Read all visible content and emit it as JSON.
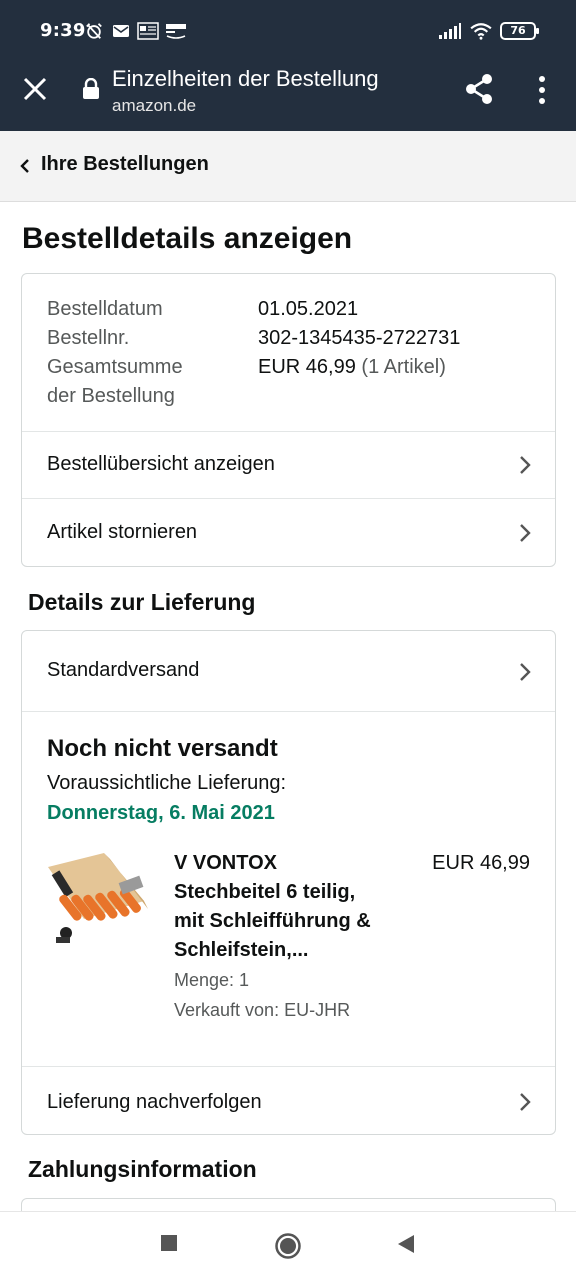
{
  "status_bar": {
    "time": "9:39",
    "battery": "76",
    "icons": [
      "alarm-off-icon",
      "mail-icon",
      "news-icon",
      "amazon-icon",
      "signal-icon",
      "wifi-icon",
      "battery-icon"
    ]
  },
  "browser": {
    "title": "Einzelheiten der Bestellung",
    "domain": "amazon.de",
    "icons": [
      "close-icon",
      "lock-icon",
      "share-icon",
      "more-vert-icon"
    ]
  },
  "breadcrumb": {
    "label": "Ihre Bestellungen"
  },
  "page": {
    "title": "Bestelldetails anzeigen"
  },
  "summary": {
    "order_date_label": "Bestelldatum",
    "order_date": "01.05.2021",
    "order_no_label": "Bestellnr.",
    "order_no": "302-1345435-2722731",
    "total_label_1": "Gesamtsumme",
    "total_label_2": "der Bestellung",
    "total_value": "EUR 46,99",
    "total_items": "(1 Artikel)",
    "link_overview": "Bestellübersicht anzeigen",
    "link_cancel": "Artikel stornieren"
  },
  "delivery": {
    "section_title": "Details zur Lieferung",
    "shipping_method": "Standardversand",
    "status": "Noch nicht versandt",
    "eta_label": "Voraussichtliche Lieferung:",
    "eta_date": "Donnerstag, 6. Mai 2021",
    "eta_color": "#067d62",
    "product": {
      "name_line1": "V VONTOX",
      "name_line2": "Stechbeitel 6 teilig,",
      "name_line3": "mit Schleifführung &",
      "name_line4": "Schleifstein,...",
      "price": "EUR 46,99",
      "quantity": "Menge: 1",
      "seller": "Verkauft von: EU-JHR"
    },
    "track_link": "Lieferung nachverfolgen"
  },
  "payment": {
    "section_title": "Zahlungsinformation"
  },
  "colors": {
    "header_bg": "#232f3e",
    "accent_green": "#067d62"
  }
}
